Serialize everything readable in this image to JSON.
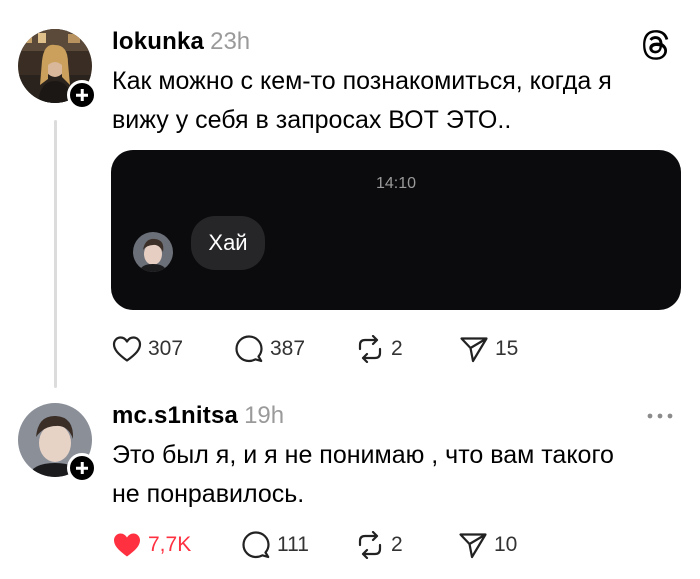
{
  "post1": {
    "username": "lokunka",
    "time": "23h",
    "text_line1": "Как можно с кем-то познакомиться, когда я",
    "text_line2": "вижу у себя в запросах ВОТ ЭТО..",
    "dm": {
      "timestamp": "14:10",
      "message": "Хай"
    },
    "actions": {
      "likes": "307",
      "replies": "387",
      "reposts": "2",
      "shares": "15"
    }
  },
  "post2": {
    "username": "mc.s1nitsa",
    "time": "19h",
    "text_line1": "Это был я, и я не понимаю , что вам такого",
    "text_line2": "не понравилось.",
    "actions": {
      "likes": "7,7K",
      "replies": "111",
      "reposts": "2",
      "shares": "10"
    }
  },
  "colors": {
    "like_active": "#ff3040",
    "muted": "#9a9a9a",
    "card_bg": "#0b0b0d",
    "bubble_bg": "#262629"
  },
  "icons": [
    "threads-logo-icon",
    "heart-icon",
    "comment-icon",
    "repost-icon",
    "share-icon",
    "more-icon",
    "plus-icon"
  ]
}
